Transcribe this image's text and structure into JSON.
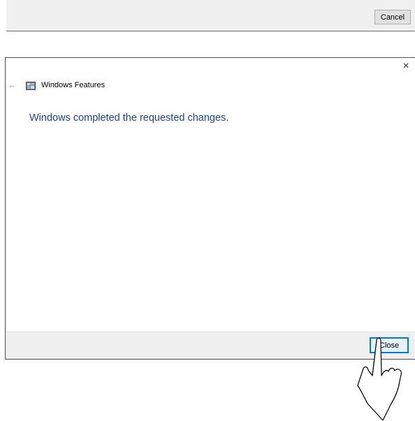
{
  "top_dialog": {
    "cancel_label": "Cancel"
  },
  "dialog": {
    "close_glyph": "×",
    "back_glyph": "←",
    "app_title": "Windows Features",
    "message": "Windows completed the requested changes.",
    "close_label": "Close"
  },
  "icons": {
    "back": "back-arrow-icon",
    "app": "windows-features-icon",
    "close": "close-icon",
    "cursor": "hand-pointer-icon"
  },
  "colors": {
    "message_text": "#1e3f91",
    "accent": "#0078d7"
  }
}
